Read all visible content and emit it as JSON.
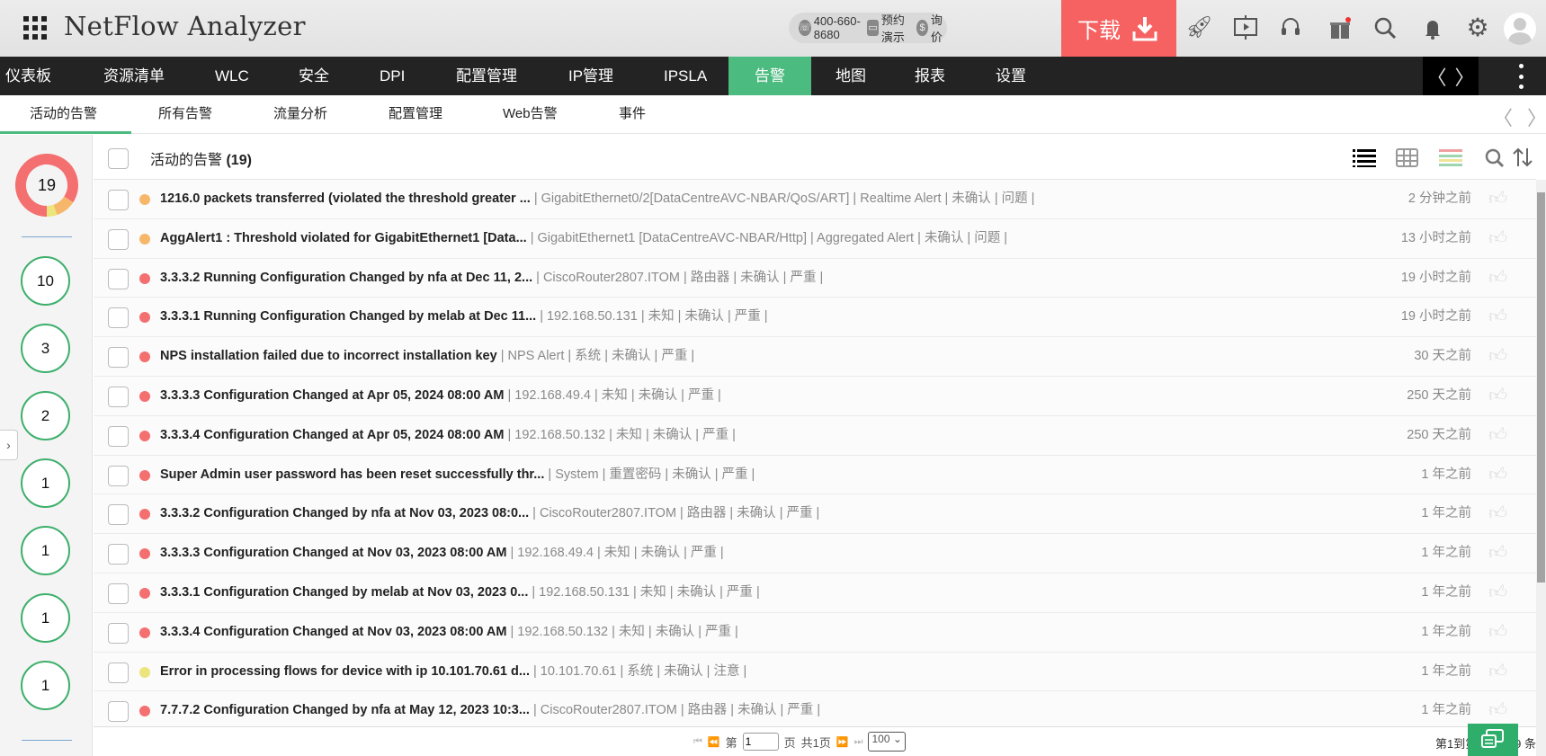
{
  "app": {
    "title": "NetFlow Analyzer"
  },
  "header": {
    "phone": "400-660-8680",
    "demo": "预约演示",
    "price": "询价",
    "download": "下载",
    "icons": [
      "rocket-icon",
      "presentation-icon",
      "headset-icon",
      "gift-icon",
      "search-icon",
      "bell-icon",
      "gear-icon",
      "avatar"
    ]
  },
  "nav": {
    "items": [
      "仪表板",
      "资源清单",
      "WLC",
      "安全",
      "DPI",
      "配置管理",
      "IP管理",
      "IPSLA",
      "告警",
      "地图",
      "报表",
      "设置"
    ],
    "active": "告警"
  },
  "subnav": {
    "items": [
      "活动的告警",
      "所有告警",
      "流量分析",
      "配置管理",
      "Web告警",
      "事件"
    ],
    "active": "活动的告警"
  },
  "summary": {
    "total": "19",
    "donut": {
      "critical": 16,
      "trouble": 2,
      "attention": 1
    },
    "counts": [
      "10",
      "3",
      "2",
      "1",
      "1",
      "1",
      "1"
    ]
  },
  "list": {
    "title": "活动的告警",
    "count": "(19)",
    "colors": {
      "critical": "#f46f6f",
      "trouble": "#f7b76b",
      "attention": "#ece47c"
    },
    "rows": [
      {
        "sev": "trouble",
        "msg": "1216.0 packets transferred (violated the threshold greater ...",
        "detail": " | GigabitEthernet0/2[DataCentreAVC-NBAR/QoS/ART] | Realtime Alert | 未确认 | 问题 |",
        "age": "2 分钟之前"
      },
      {
        "sev": "trouble",
        "msg": "AggAlert1 : Threshold violated for GigabitEthernet1 [Data...",
        "detail": "  | GigabitEthernet1 [DataCentreAVC-NBAR/Http] | Aggregated Alert | 未确认 | 问题 |",
        "age": "13 小时之前"
      },
      {
        "sev": "critical",
        "msg": "3.3.3.2 Running Configuration Changed by nfa at Dec 11, 2...",
        "detail": "  | CiscoRouter2807.ITOM | 路由器 | 未确认 | 严重 |",
        "age": "19 小时之前"
      },
      {
        "sev": "critical",
        "msg": "3.3.3.1 Running Configuration Changed by melab at Dec 11...",
        "detail": " | 192.168.50.131 | 未知 | 未确认 | 严重 |",
        "age": "19 小时之前"
      },
      {
        "sev": "critical",
        "msg": "NPS installation failed due to incorrect installation key",
        "detail": " | NPS Alert | 系统 | 未确认 | 严重 |",
        "age": "30 天之前"
      },
      {
        "sev": "critical",
        "msg": "3.3.3.3 Configuration Changed at Apr 05, 2024 08:00 AM",
        "detail": " | 192.168.49.4 | 未知 | 未确认 | 严重 |",
        "age": "250 天之前"
      },
      {
        "sev": "critical",
        "msg": "3.3.3.4 Configuration Changed at Apr 05, 2024 08:00 AM",
        "detail": " | 192.168.50.132 | 未知 | 未确认 | 严重 |",
        "age": "250 天之前"
      },
      {
        "sev": "critical",
        "msg": "Super Admin user password has been reset successfully thr...",
        "detail": " | System | 重置密码 | 未确认 | 严重 |",
        "age": "1 年之前"
      },
      {
        "sev": "critical",
        "msg": "3.3.3.2 Configuration Changed by nfa at Nov 03, 2023 08:0...",
        "detail": "  | CiscoRouter2807.ITOM | 路由器 | 未确认 | 严重 |",
        "age": "1 年之前"
      },
      {
        "sev": "critical",
        "msg": "3.3.3.3 Configuration Changed at Nov 03, 2023 08:00 AM",
        "detail": " | 192.168.49.4 | 未知 | 未确认 | 严重 |",
        "age": "1 年之前"
      },
      {
        "sev": "critical",
        "msg": "3.3.3.1 Configuration Changed by melab at Nov 03, 2023 0...",
        "detail": "  | 192.168.50.131 | 未知 | 未确认 | 严重 |",
        "age": "1 年之前"
      },
      {
        "sev": "critical",
        "msg": "3.3.3.4 Configuration Changed at Nov 03, 2023 08:00 AM",
        "detail": " | 192.168.50.132 | 未知 | 未确认 | 严重 |",
        "age": "1 年之前"
      },
      {
        "sev": "attention",
        "msg": "Error in processing flows for device with ip 10.101.70.61 d...",
        "detail": "  | 10.101.70.61 | 系统 | 未确认 | 注意 |",
        "age": "1 年之前"
      },
      {
        "sev": "critical",
        "msg": "7.7.7.2 Configuration Changed by nfa at May 12, 2023 10:3...",
        "detail": " | CiscoRouter2807.ITOM | 路由器 | 未确认 | 严重 |",
        "age": "1 年之前"
      }
    ]
  },
  "footer": {
    "page_prefix": "第",
    "page_value": "1",
    "page_suffix": "页",
    "total_pages": "共1页",
    "per_page": "100",
    "range": "第1到第19 共 19 条"
  }
}
